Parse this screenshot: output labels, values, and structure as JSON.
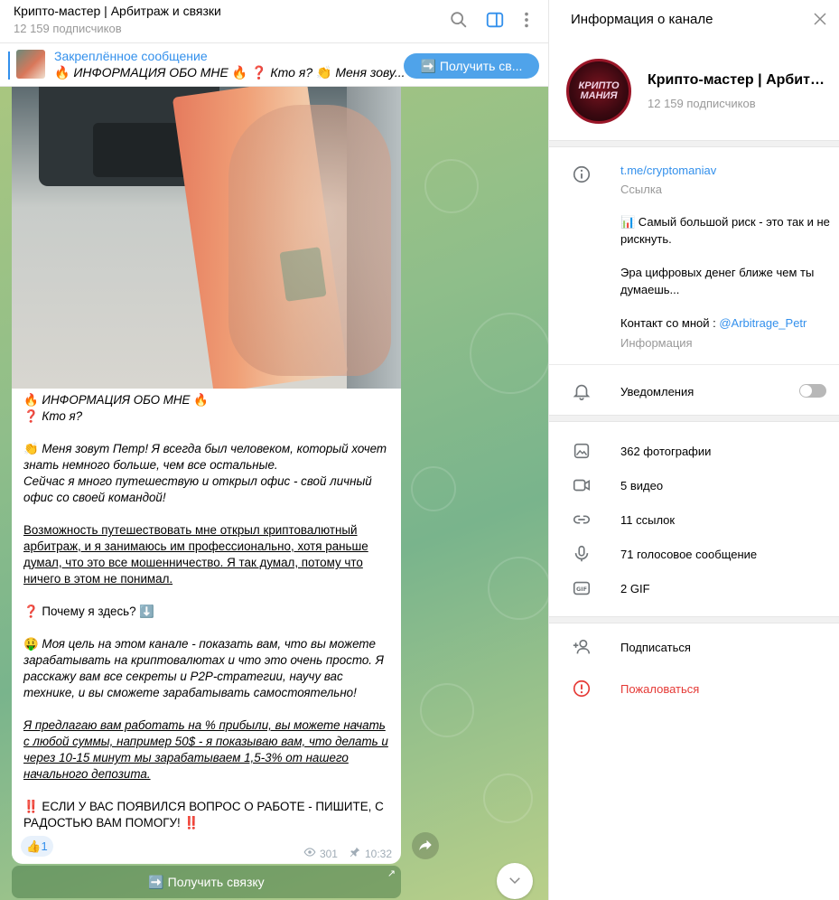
{
  "chat": {
    "title": "Крипто-мастер | Арбитраж и связки",
    "subscribers": "12 159 подписчиков",
    "pinned": {
      "label": "Закреплённое сообщение",
      "preview_fire1": "🔥",
      "preview_text1": "ИНФОРМАЦИЯ ОБО МНЕ",
      "preview_fire2": "🔥",
      "preview_q": "❓",
      "preview_text2": "Кто я?",
      "preview_clap": "👏",
      "preview_text3": "Меня зову...",
      "button": "➡️ Получить св..."
    },
    "message": {
      "line1_icon": "🔥",
      "line1": "ИНФОРМАЦИЯ ОБО МНЕ",
      "line1_icon2": "🔥",
      "line2_icon": "❓",
      "line2": "Кто я?",
      "p1_icon": "👏",
      "p1": "Меня зовут Петр! Я всегда был человеком, который хочет знать немного больше, чем все остальные.",
      "p1b": "Сейчас я много путешествую и открыл офис - свой личный офис со своей командой!",
      "p2": "Возможность путешествовать мне открыл криптовалютный арбитраж, и я занимаюсь им профессионально, хотя раньше думал, что это все мошенничество. Я так думал, потому что ничего в этом не понимал.",
      "p3_icon": "❓",
      "p3": "Почему я здесь?",
      "p3_icon2": "⬇️",
      "p4_icon": "🤑",
      "p4": "Моя цель на этом канале - показать вам, что вы можете зарабатывать на криптовалютах и что это очень просто. Я расскажу вам все секреты и P2P-стратегии, научу вас технике, и вы сможете зарабатывать самостоятельно!",
      "p5": "Я предлагаю вам работать на % прибыли, вы можете начать с любой суммы, например 50$ - я показываю вам, что делать и через 10-15 минут мы зарабатываем 1,5-3% от нашего начального депозита.",
      "p6_icon": "‼️",
      "p6": "ЕСЛИ У ВАС ПОЯВИЛСЯ ВОПРОС О РАБОТЕ - ПИШИТЕ, С РАДОСТЬЮ ВАМ ПОМОГУ!",
      "p6_icon2": "‼️",
      "reaction_emoji": "👍",
      "reaction_count": "1",
      "views": "301",
      "time": "10:32",
      "inline_button": "➡️ Получить связку"
    }
  },
  "panel": {
    "title": "Информация о канале",
    "avatar_text_line1": "КРИПТО",
    "avatar_text_line2": "МАНИЯ",
    "channel_name": "Крипто-мастер | Арбитраж и связки",
    "subscribers": "12 159 подписчиков",
    "link": "t.me/cryptomaniav",
    "link_caption": "Ссылка",
    "about_line1": "📊 Самый большой риск - это так и не рискнуть.",
    "about_line2": "Эра цифровых денег ближе чем ты думаешь...",
    "about_contact_prefix": "Контакт со мной : ",
    "about_contact_handle": "@Arbitrage_Petr",
    "about_caption": "Информация",
    "notifications": "Уведомления",
    "notifications_on": false,
    "media": [
      {
        "icon": "photo-icon",
        "label": "362 фотографии"
      },
      {
        "icon": "video-icon",
        "label": "5 видео"
      },
      {
        "icon": "link-icon",
        "label": "11 ссылок"
      },
      {
        "icon": "microphone-icon",
        "label": "71 голосовое сообщение"
      },
      {
        "icon": "gif-icon",
        "label": "2 GIF"
      }
    ],
    "subscribe": "Подписаться",
    "report": "Пожаловаться"
  },
  "colors": {
    "accent": "#3390ec",
    "danger": "#e53935",
    "muted": "#999999"
  }
}
